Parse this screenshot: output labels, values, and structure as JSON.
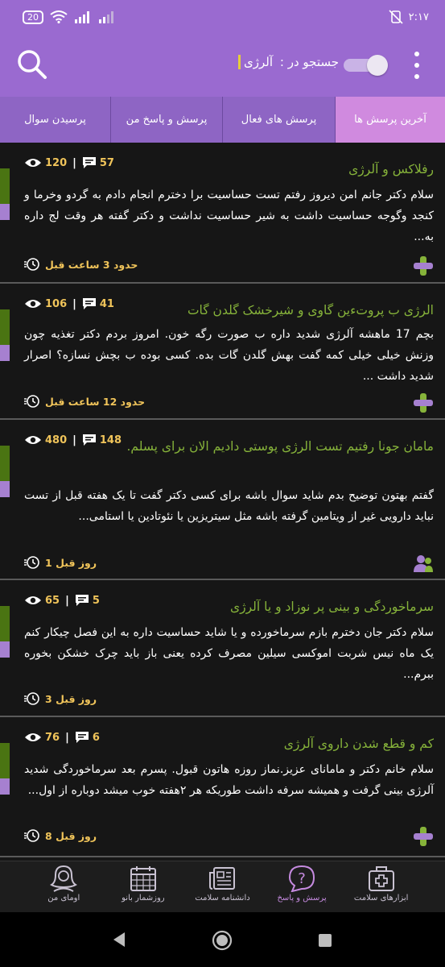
{
  "status_bar": {
    "battery": "20",
    "time": "۲:۱۷",
    "icons": [
      "wifi-icon",
      "signal-icon",
      "signal-icon",
      "vibrate-off-icon"
    ]
  },
  "app_bar": {
    "search_label": "جستجو در :",
    "search_value": "آلرژی",
    "toggle_on": true
  },
  "tabs": [
    {
      "label": "آخرین پرسش ها",
      "active": true
    },
    {
      "label": "پرسش های فعال",
      "active": false
    },
    {
      "label": "پرسش و پاسخ من",
      "active": false
    },
    {
      "label": "پرسیدن سوال",
      "active": false
    }
  ],
  "posts": [
    {
      "title": "رفلاکس و آلرژی",
      "views": "120",
      "comments": "57",
      "body": "سلام دکتر جانم امن دیروز رفتم تست حساسیت برا دخترم انجام دادم به گردو وخرما و کنجد وگوجه حساسیت داشت به شیر حساسیت نداشت و دکتر گفته هر وقت لج داره به...",
      "time": "حدود 3 ساعت قبل",
      "icon": "cross-icon"
    },
    {
      "title": "الرژی ب پروت‌ءین گاوی و شیرخشک گلدن گات",
      "views": "106",
      "comments": "41",
      "body": "بچم 17 ماهشه آلرژی شدید داره ب صورت رگه خون. امروز بردم دکتر تغذیه چون وزنش خیلی خیلی کمه گفت بهش گلدن گات بده. کسی بوده ب بچش نسازه؟ اصرار شدید داشت ...",
      "time": "حدود 12 ساعت قبل",
      "icon": "cross-icon"
    },
    {
      "title": "مامان جونا رفتیم تست الرژی پوستی دادیم الان برای پسلم.",
      "views": "480",
      "comments": "148",
      "body": "گفتم بهتون توضیح بدم شاید سوال باشه برای کسی  دکتر گفت تا یک هفته قبل از تست نباید دارویی غیر از ویتامین گرفته باشه مثل سیتریزین یا نئوتادین یا استامی...",
      "time": "1 روز قبل",
      "icon": "users-icon"
    },
    {
      "title": "سرماخوردگی و بینی پر نوزاد و یا آلرژی",
      "views": "65",
      "comments": "5",
      "body": "سلام دکتر جان دخترم بازم سرماخورده و یا شاید حساسیت داره به این فصل چیکار کنم یک ماه نیس شربت اموکسی سیلین مصرف کرده یعنی باز باید چرک خشکن بخوره ببرم...",
      "time": "3 روز قبل",
      "icon": "none"
    },
    {
      "title": "کم و قطع شدن داروی آلرژی",
      "views": "76",
      "comments": "6",
      "body": "سلام خانم دکتر و مامانای عزیز.نماز روزه هاتون قبول.  پسرم بعد سرماخوردگی شدید آلرژی بینی گرفت و همیشه سرفه داشت طوریکه هر ۲هفته خوب میشد دوباره از اول...",
      "time": "8 روز قبل",
      "icon": "cross-icon"
    }
  ],
  "bottom_nav": [
    {
      "label": "ابزارهای سلامت",
      "icon": "medkit-icon",
      "active": false
    },
    {
      "label": "پرسش و پاسخ",
      "icon": "question-icon",
      "active": true
    },
    {
      "label": "دانشنامه سلامت",
      "icon": "newspaper-icon",
      "active": false
    },
    {
      "label": "روزشمار بانو",
      "icon": "calendar-icon",
      "active": false
    },
    {
      "label": "اومای من",
      "icon": "profile-icon",
      "active": false
    }
  ],
  "colors": {
    "primary": "#9a6ad0",
    "tab_active": "#d08adf",
    "title_green": "#86b33a",
    "count_yellow": "#f0c45a"
  }
}
